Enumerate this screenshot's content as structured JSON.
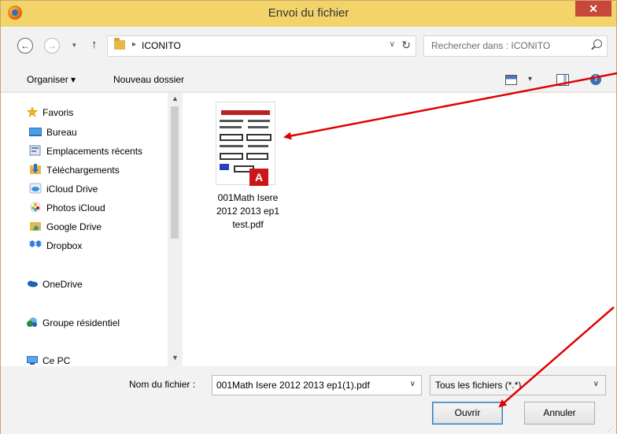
{
  "window": {
    "title": "Envoi du fichier",
    "close_glyph": "✕"
  },
  "nav": {
    "back_glyph": "←",
    "forward_glyph": "→",
    "recent_glyph": "▾",
    "up_glyph": "↑",
    "path_sep": "▸",
    "path": "ICONITO",
    "addr_dropdown": "∨",
    "refresh_glyph": "↻",
    "search_placeholder": "Rechercher dans : ICONITO"
  },
  "toolbar": {
    "organize": "Organiser ▾",
    "new_folder": "Nouveau dossier",
    "view_dropdown": "▾",
    "help_glyph": "?"
  },
  "sidebar": {
    "scroll_up": "▲",
    "scroll_down": "▼",
    "favorites": "Favoris",
    "items": [
      "Bureau",
      "Emplacements récents",
      "Téléchargements",
      "iCloud Drive",
      "Photos iCloud",
      "Google Drive",
      "Dropbox"
    ],
    "onedrive": "OneDrive",
    "homegroup": "Groupe résidentiel",
    "this_pc": "Ce PC"
  },
  "files": [
    {
      "name_lines": [
        "001Math Isere",
        "2012 2013 ep1",
        "test.pdf"
      ],
      "type": "pdf",
      "badge": "A"
    }
  ],
  "bottom": {
    "filename_label": "Nom du fichier :",
    "filename_value": "001Math Isere 2012 2013 ep1(1).pdf",
    "filetype_value": "Tous les fichiers (*.*)",
    "dropdown_glyph": "∨",
    "open_label": "Ouvrir",
    "cancel_label": "Annuler",
    "grip_glyph": "⋰"
  },
  "annotation_color": "#e00000"
}
